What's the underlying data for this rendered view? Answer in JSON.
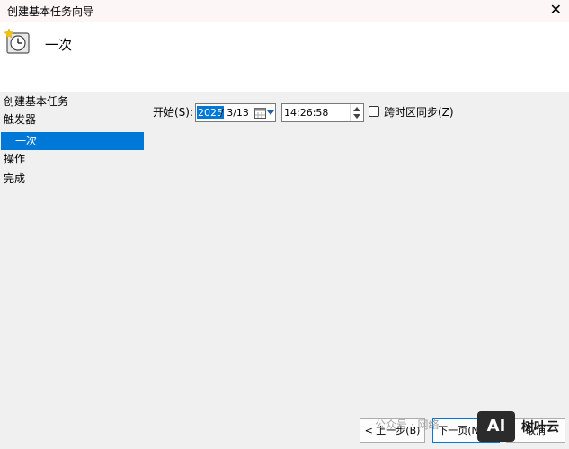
{
  "window": {
    "title": "创建基本任务向导",
    "close_glyph": "✕"
  },
  "header": {
    "icon": "scheduled-task-clock-icon",
    "heading": "一次"
  },
  "sidebar": {
    "items": [
      {
        "label": "创建基本任务"
      },
      {
        "label": "触发器"
      },
      {
        "label": "一次",
        "selected": true
      },
      {
        "label": "操作"
      },
      {
        "label": "完成"
      }
    ]
  },
  "form": {
    "start_label": "开始(S):",
    "date_year": "2025",
    "date_rest": "/  3/13",
    "time_value": "14:26:58",
    "timezone_sync_label": "跨时区同步(Z)",
    "timezone_sync_checked": false
  },
  "buttons": {
    "back": "< 上一步(B)",
    "next": "下一页(N) >",
    "cancel": "取消"
  },
  "watermark": {
    "text": "公众号 · 网络",
    "logo_text": "AI",
    "brand": "树叶云"
  },
  "colors": {
    "selection": "#0078d7",
    "titlebar_bg": "#fdf6f6",
    "panel_bg": "#f0f0f0"
  }
}
